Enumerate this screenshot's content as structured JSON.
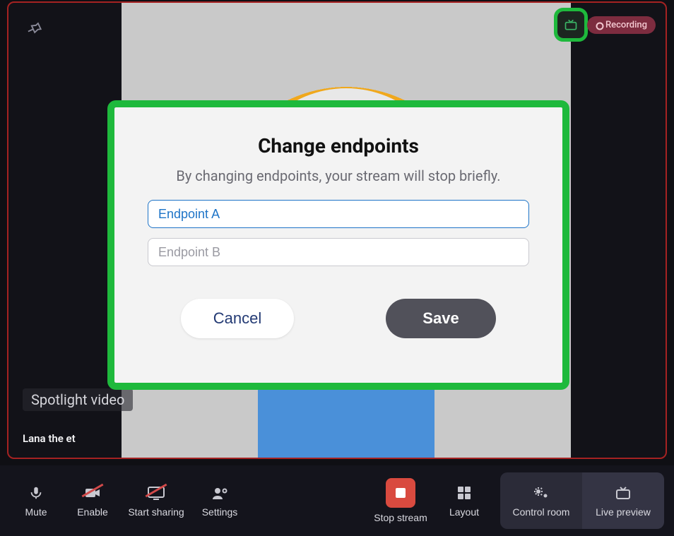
{
  "stage": {
    "spotlight_label": "Spotlight video",
    "participant_name": "Lana the et",
    "recording_label": "Recording"
  },
  "modal": {
    "title": "Change endpoints",
    "subtitle": "By changing endpoints, your stream will stop briefly.",
    "endpoint_a_value": "Endpoint A",
    "endpoint_b_placeholder": "Endpoint B",
    "cancel_label": "Cancel",
    "save_label": "Save"
  },
  "toolbar": {
    "mute": "Mute",
    "enable": "Enable",
    "start_sharing": "Start sharing",
    "settings": "Settings",
    "stop_stream": "Stop stream",
    "layout": "Layout",
    "control_room": "Control room",
    "live_preview": "Live preview"
  }
}
